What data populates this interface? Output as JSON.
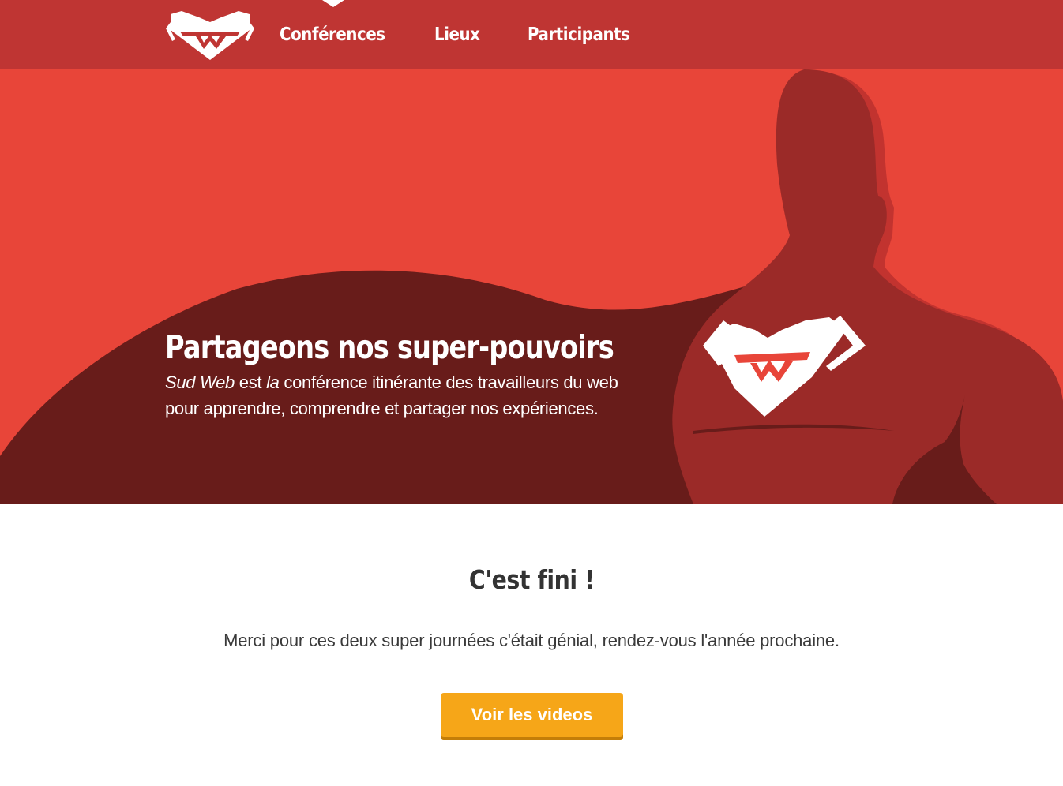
{
  "nav": {
    "items": [
      {
        "label": "Conférences"
      },
      {
        "label": "Lieux"
      },
      {
        "label": "Participants"
      }
    ]
  },
  "hero": {
    "title": "Partageons nos super-pouvoirs",
    "desc_em1": "Sud Web",
    "desc_mid1": " est ",
    "desc_em2": "la",
    "desc_rest": " conférence itinérante des travailleurs du web pour apprendre, comprendre et partager nos expériences."
  },
  "content": {
    "title": "C'est fini !",
    "text": "Merci pour ces deux super journées c'était génial, rendez-vous l'année prochaine.",
    "button_label": "Voir les videos"
  },
  "colors": {
    "nav_bg": "#bf3533",
    "hero_bg": "#e84539",
    "cape": "#681c1a",
    "hero_body": "#9b2a28",
    "button": "#f6a618"
  }
}
